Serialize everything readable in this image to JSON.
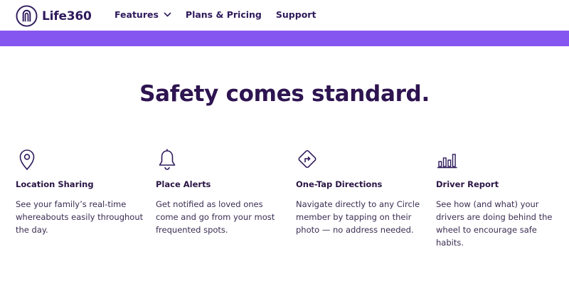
{
  "brand": {
    "name": "Life360"
  },
  "nav": {
    "items": [
      {
        "label": "Features",
        "has_dropdown": true
      },
      {
        "label": "Plans & Pricing"
      },
      {
        "label": "Support"
      }
    ]
  },
  "colors": {
    "brand_purple": "#8657f0",
    "text_dark": "#2e1450"
  },
  "hero": {
    "headline": "Safety comes standard."
  },
  "features": [
    {
      "icon": "map-pin-icon",
      "title": "Location Sharing",
      "description": "See your family’s real-time whereabouts easily throughout the day."
    },
    {
      "icon": "bell-icon",
      "title": "Place Alerts",
      "description": "Get notified as loved ones come and go from your most frequented spots."
    },
    {
      "icon": "directions-sign-icon",
      "title": "One-Tap Directions",
      "description": "Navigate directly to any Circle member by tapping on their photo — no address needed."
    },
    {
      "icon": "bar-chart-icon",
      "title": "Driver Report",
      "description": "See how (and what) your drivers are doing behind the wheel to encourage safe habits."
    }
  ]
}
